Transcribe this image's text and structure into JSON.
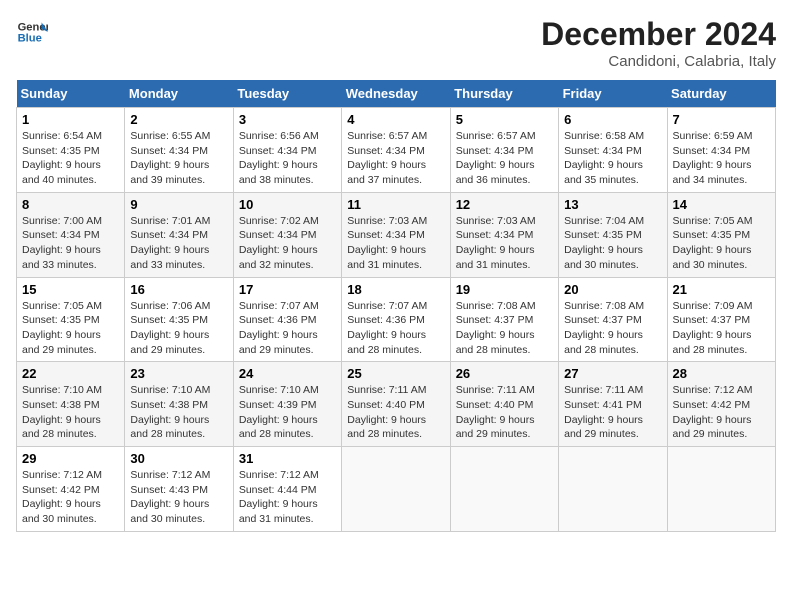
{
  "logo": {
    "line1": "General",
    "line2": "Blue"
  },
  "title": "December 2024",
  "location": "Candidoni, Calabria, Italy",
  "weekdays": [
    "Sunday",
    "Monday",
    "Tuesday",
    "Wednesday",
    "Thursday",
    "Friday",
    "Saturday"
  ],
  "weeks": [
    [
      {
        "day": "1",
        "sunrise": "6:54 AM",
        "sunset": "4:35 PM",
        "daylight": "9 hours and 40 minutes."
      },
      {
        "day": "2",
        "sunrise": "6:55 AM",
        "sunset": "4:34 PM",
        "daylight": "9 hours and 39 minutes."
      },
      {
        "day": "3",
        "sunrise": "6:56 AM",
        "sunset": "4:34 PM",
        "daylight": "9 hours and 38 minutes."
      },
      {
        "day": "4",
        "sunrise": "6:57 AM",
        "sunset": "4:34 PM",
        "daylight": "9 hours and 37 minutes."
      },
      {
        "day": "5",
        "sunrise": "6:57 AM",
        "sunset": "4:34 PM",
        "daylight": "9 hours and 36 minutes."
      },
      {
        "day": "6",
        "sunrise": "6:58 AM",
        "sunset": "4:34 PM",
        "daylight": "9 hours and 35 minutes."
      },
      {
        "day": "7",
        "sunrise": "6:59 AM",
        "sunset": "4:34 PM",
        "daylight": "9 hours and 34 minutes."
      }
    ],
    [
      {
        "day": "8",
        "sunrise": "7:00 AM",
        "sunset": "4:34 PM",
        "daylight": "9 hours and 33 minutes."
      },
      {
        "day": "9",
        "sunrise": "7:01 AM",
        "sunset": "4:34 PM",
        "daylight": "9 hours and 33 minutes."
      },
      {
        "day": "10",
        "sunrise": "7:02 AM",
        "sunset": "4:34 PM",
        "daylight": "9 hours and 32 minutes."
      },
      {
        "day": "11",
        "sunrise": "7:03 AM",
        "sunset": "4:34 PM",
        "daylight": "9 hours and 31 minutes."
      },
      {
        "day": "12",
        "sunrise": "7:03 AM",
        "sunset": "4:34 PM",
        "daylight": "9 hours and 31 minutes."
      },
      {
        "day": "13",
        "sunrise": "7:04 AM",
        "sunset": "4:35 PM",
        "daylight": "9 hours and 30 minutes."
      },
      {
        "day": "14",
        "sunrise": "7:05 AM",
        "sunset": "4:35 PM",
        "daylight": "9 hours and 30 minutes."
      }
    ],
    [
      {
        "day": "15",
        "sunrise": "7:05 AM",
        "sunset": "4:35 PM",
        "daylight": "9 hours and 29 minutes."
      },
      {
        "day": "16",
        "sunrise": "7:06 AM",
        "sunset": "4:35 PM",
        "daylight": "9 hours and 29 minutes."
      },
      {
        "day": "17",
        "sunrise": "7:07 AM",
        "sunset": "4:36 PM",
        "daylight": "9 hours and 29 minutes."
      },
      {
        "day": "18",
        "sunrise": "7:07 AM",
        "sunset": "4:36 PM",
        "daylight": "9 hours and 28 minutes."
      },
      {
        "day": "19",
        "sunrise": "7:08 AM",
        "sunset": "4:37 PM",
        "daylight": "9 hours and 28 minutes."
      },
      {
        "day": "20",
        "sunrise": "7:08 AM",
        "sunset": "4:37 PM",
        "daylight": "9 hours and 28 minutes."
      },
      {
        "day": "21",
        "sunrise": "7:09 AM",
        "sunset": "4:37 PM",
        "daylight": "9 hours and 28 minutes."
      }
    ],
    [
      {
        "day": "22",
        "sunrise": "7:10 AM",
        "sunset": "4:38 PM",
        "daylight": "9 hours and 28 minutes."
      },
      {
        "day": "23",
        "sunrise": "7:10 AM",
        "sunset": "4:38 PM",
        "daylight": "9 hours and 28 minutes."
      },
      {
        "day": "24",
        "sunrise": "7:10 AM",
        "sunset": "4:39 PM",
        "daylight": "9 hours and 28 minutes."
      },
      {
        "day": "25",
        "sunrise": "7:11 AM",
        "sunset": "4:40 PM",
        "daylight": "9 hours and 28 minutes."
      },
      {
        "day": "26",
        "sunrise": "7:11 AM",
        "sunset": "4:40 PM",
        "daylight": "9 hours and 29 minutes."
      },
      {
        "day": "27",
        "sunrise": "7:11 AM",
        "sunset": "4:41 PM",
        "daylight": "9 hours and 29 minutes."
      },
      {
        "day": "28",
        "sunrise": "7:12 AM",
        "sunset": "4:42 PM",
        "daylight": "9 hours and 29 minutes."
      }
    ],
    [
      {
        "day": "29",
        "sunrise": "7:12 AM",
        "sunset": "4:42 PM",
        "daylight": "9 hours and 30 minutes."
      },
      {
        "day": "30",
        "sunrise": "7:12 AM",
        "sunset": "4:43 PM",
        "daylight": "9 hours and 30 minutes."
      },
      {
        "day": "31",
        "sunrise": "7:12 AM",
        "sunset": "4:44 PM",
        "daylight": "9 hours and 31 minutes."
      },
      null,
      null,
      null,
      null
    ]
  ]
}
